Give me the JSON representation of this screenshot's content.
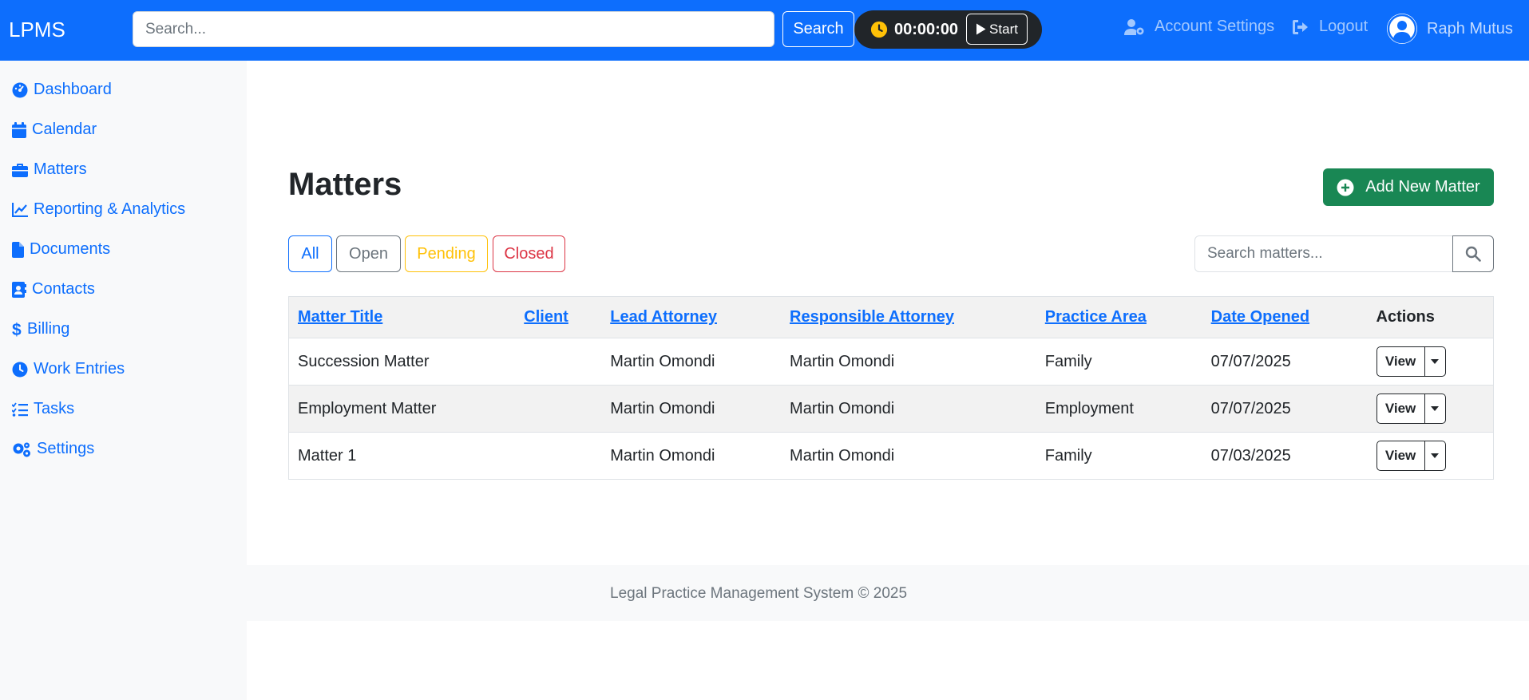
{
  "navbar": {
    "brand": "LPMS",
    "search_placeholder": "Search...",
    "search_button": "Search",
    "timer_value": "00:00:00",
    "timer_start": "Start",
    "account_settings": "Account Settings",
    "logout": "Logout",
    "user_name": "Raph Mutus"
  },
  "sidebar": {
    "items": [
      {
        "label": "Dashboard",
        "icon": "gauge-icon"
      },
      {
        "label": "Calendar",
        "icon": "calendar-icon"
      },
      {
        "label": "Matters",
        "icon": "briefcase-icon"
      },
      {
        "label": "Reporting & Analytics",
        "icon": "chart-line-icon"
      },
      {
        "label": "Documents",
        "icon": "file-icon"
      },
      {
        "label": "Contacts",
        "icon": "address-book-icon"
      },
      {
        "label": "Billing",
        "icon": "dollar-icon"
      },
      {
        "label": "Work Entries",
        "icon": "clock-icon"
      },
      {
        "label": "Tasks",
        "icon": "list-check-icon"
      },
      {
        "label": "Settings",
        "icon": "gears-icon"
      }
    ]
  },
  "main": {
    "title": "Matters",
    "add_button": "Add New Matter",
    "filters": {
      "all": "All",
      "open": "Open",
      "pending": "Pending",
      "closed": "Closed"
    },
    "search_placeholder": "Search matters...",
    "table": {
      "headers": {
        "title": "Matter Title",
        "client": "Client",
        "lead": "Lead Attorney",
        "responsible": "Responsible Attorney",
        "practice": "Practice Area",
        "opened": "Date Opened",
        "actions": "Actions"
      },
      "view_label": "View",
      "rows": [
        {
          "title": "Succession Matter",
          "client": "",
          "lead": "Martin Omondi",
          "responsible": "Martin Omondi",
          "practice": "Family",
          "opened": "07/07/2025"
        },
        {
          "title": "Employment Matter",
          "client": "",
          "lead": "Martin Omondi",
          "responsible": "Martin Omondi",
          "practice": "Employment",
          "opened": "07/07/2025"
        },
        {
          "title": "Matter 1",
          "client": "",
          "lead": "Martin Omondi",
          "responsible": "Martin Omondi",
          "practice": "Family",
          "opened": "07/03/2025"
        }
      ]
    }
  },
  "footer": {
    "text": "Legal Practice Management System © 2025"
  },
  "colors": {
    "primary": "#0d6efd",
    "success": "#198754",
    "warning": "#ffc107",
    "danger": "#dc3545",
    "dark": "#212529"
  }
}
